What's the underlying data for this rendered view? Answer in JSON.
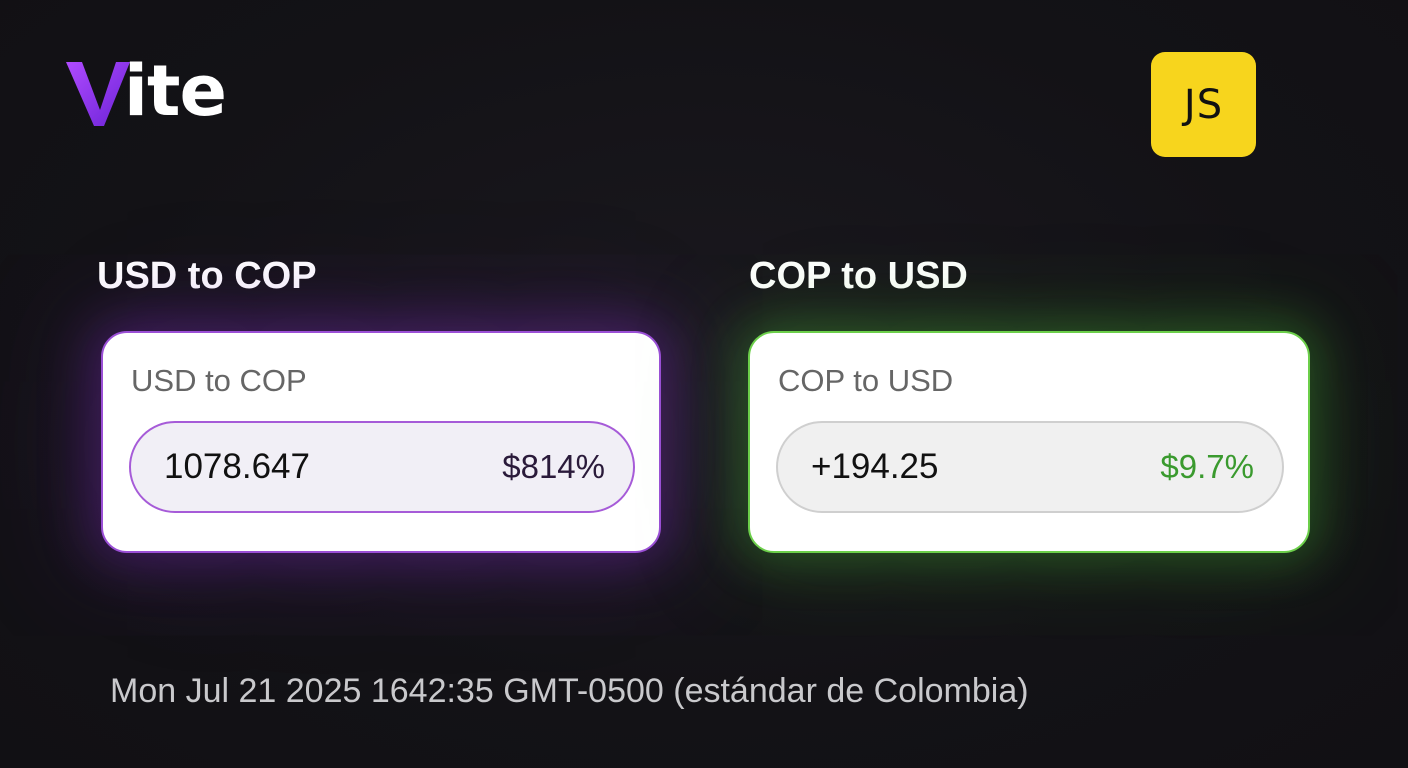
{
  "header": {
    "logo_text": "ite",
    "badge_text": "JS"
  },
  "colors": {
    "background": "#121115",
    "logo_gradient_start": "#9b35ff",
    "logo_gradient_end": "#6e2bd8",
    "badge_yellow": "#f7d51d",
    "left_accent": "#9b4fd6",
    "right_accent": "#6ccf4a",
    "positive_change": "#3a9a2e"
  },
  "cards": [
    {
      "section_title": "USD to COP",
      "label": "USD to COP",
      "value": "1078.647",
      "change": "$814%"
    },
    {
      "section_title": "COP to USD",
      "label": "COP to USD",
      "value": "+194.25",
      "change": "$9.7%"
    }
  ],
  "timestamp": "Mon Jul 21 2025 1642:35 GMT-0500 (estándar de Colombia)"
}
